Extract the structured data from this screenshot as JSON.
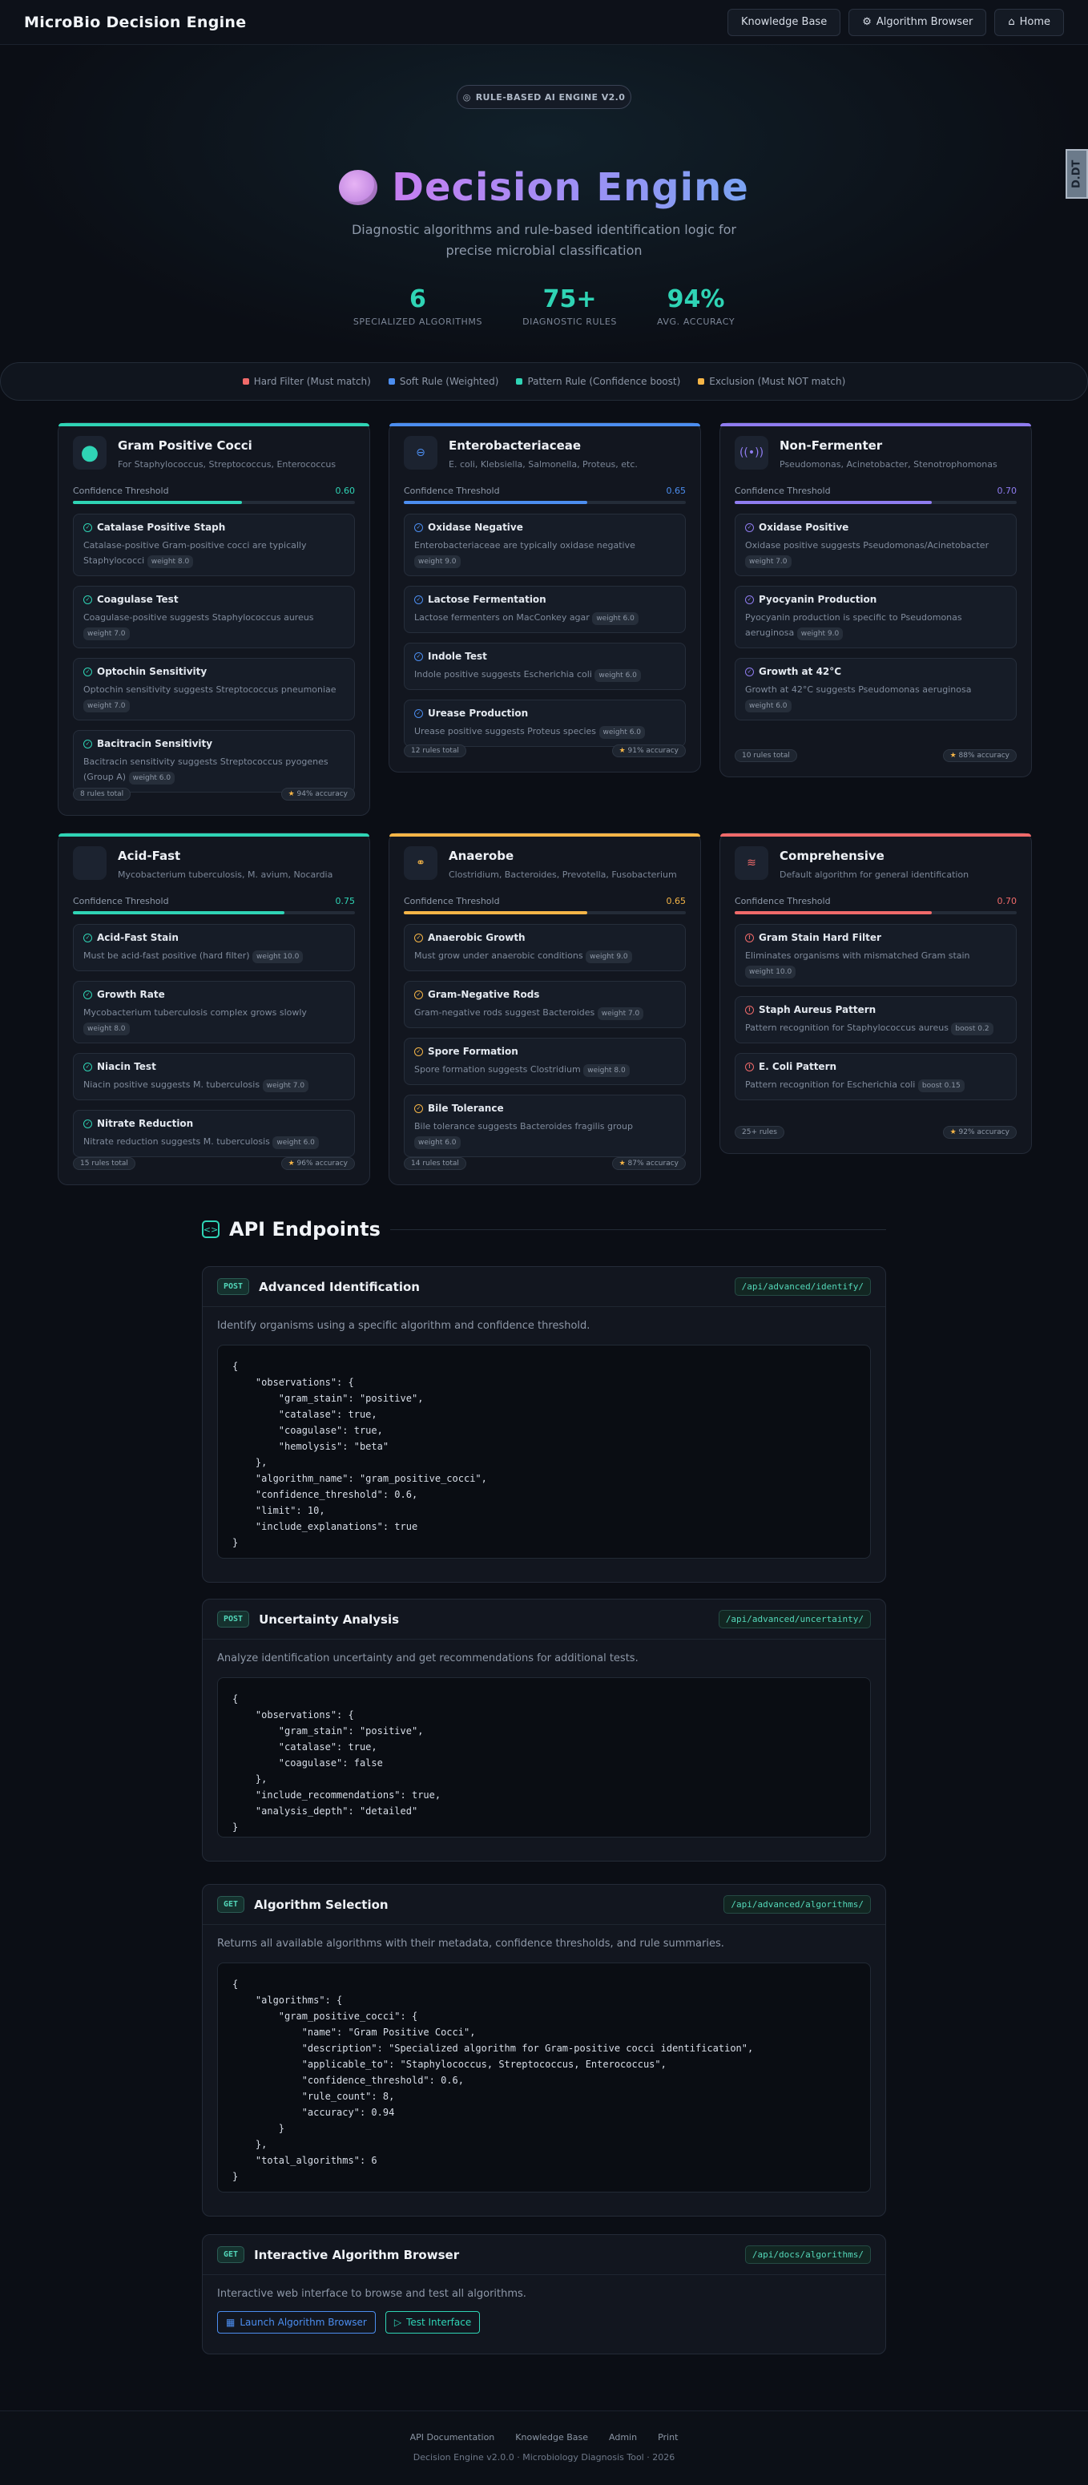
{
  "nav": {
    "brand": "MicroBio Decision Engine",
    "buttons": [
      {
        "label": "Knowledge Base",
        "icon": ""
      },
      {
        "label": "Algorithm Browser",
        "icon": "gear-icon"
      },
      {
        "label": "Home",
        "icon": "home-icon"
      }
    ]
  },
  "hero": {
    "badge": "RULE-BASED AI ENGINE V2.0",
    "title": "Decision Engine",
    "subtitle": "Diagnostic algorithms and rule-based identification logic for precise microbial classification",
    "stats": [
      {
        "value": "6",
        "label": "SPECIALIZED ALGORITHMS"
      },
      {
        "value": "75+",
        "label": "DIAGNOSTIC RULES"
      },
      {
        "value": "94%",
        "label": "AVG. ACCURACY"
      }
    ],
    "side_tab": "D.DT"
  },
  "legend": [
    {
      "label": "Hard Filter (Must match)",
      "color": "#f06a6a"
    },
    {
      "label": "Soft Rule (Weighted)",
      "color": "#4c8ef0"
    },
    {
      "label": "Pattern Rule (Confidence boost)",
      "color": "#2fd4b5"
    },
    {
      "label": "Exclusion (Must NOT match)",
      "color": "#f5b547"
    }
  ],
  "cards": [
    {
      "title": "Gram Positive Cocci",
      "subtitle": "For Staphylococcus, Streptococcus, Enterococcus",
      "threshold_label": "Confidence Threshold",
      "threshold": "0.60",
      "fill": 0.6,
      "accent": "#2fd4b5",
      "icon": "cocci-icon",
      "rules": [
        {
          "title": "Catalase Positive Staph",
          "desc": "Catalase-positive Gram-positive cocci are typically Staphylococci",
          "weight": "weight 8.0"
        },
        {
          "title": "Coagulase Test",
          "desc": "Coagulase-positive suggests Staphylococcus aureus",
          "weight": "weight 7.0"
        },
        {
          "title": "Optochin Sensitivity",
          "desc": "Optochin sensitivity suggests Streptococcus pneumoniae",
          "weight": "weight 7.0"
        },
        {
          "title": "Bacitracin Sensitivity",
          "desc": "Bacitracin sensitivity suggests Streptococcus pyogenes (Group A)",
          "weight": "weight 6.0"
        }
      ],
      "total": "8 rules total",
      "accuracy": "94% accuracy"
    },
    {
      "title": "Enterobacteriaceae",
      "subtitle": "E. coli, Klebsiella, Salmonella, Proteus, etc.",
      "threshold_label": "Confidence Threshold",
      "threshold": "0.65",
      "fill": 0.65,
      "accent": "#4c8ef0",
      "icon": "minus-circle-icon",
      "rules": [
        {
          "title": "Oxidase Negative",
          "desc": "Enterobacteriaceae are typically oxidase negative",
          "weight": "weight 9.0"
        },
        {
          "title": "Lactose Fermentation",
          "desc": "Lactose fermenters on MacConkey agar",
          "weight": "weight 6.0"
        },
        {
          "title": "Indole Test",
          "desc": "Indole positive suggests Escherichia coli",
          "weight": "weight 6.0"
        },
        {
          "title": "Urease Production",
          "desc": "Urease positive suggests Proteus species",
          "weight": "weight 6.0"
        }
      ],
      "total": "12 rules total",
      "accuracy": "91% accuracy"
    },
    {
      "title": "Non-Fermenter",
      "subtitle": "Pseudomonas, Acinetobacter, Stenotrophomonas",
      "threshold_label": "Confidence Threshold",
      "threshold": "0.70",
      "fill": 0.7,
      "accent": "#8f7cf0",
      "icon": "signal-icon",
      "rules": [
        {
          "title": "Oxidase Positive",
          "desc": "Oxidase positive suggests Pseudomonas/Acinetobacter",
          "weight": "weight 7.0"
        },
        {
          "title": "Pyocyanin Production",
          "desc": "Pyocyanin production is specific to Pseudomonas aeruginosa",
          "weight": "weight 9.0"
        },
        {
          "title": "Growth at 42°C",
          "desc": "Growth at 42°C suggests Pseudomonas aeruginosa",
          "weight": "weight 6.0"
        }
      ],
      "total": "10 rules total",
      "accuracy": "88% accuracy"
    },
    {
      "title": "Acid-Fast",
      "subtitle": "Mycobacterium tuberculosis, M. avium, Nocardia",
      "threshold_label": "Confidence Threshold",
      "threshold": "0.75",
      "fill": 0.75,
      "accent": "#2fd4b5",
      "icon": "",
      "rules": [
        {
          "title": "Acid-Fast Stain",
          "desc": "Must be acid-fast positive (hard filter)",
          "weight": "weight 10.0"
        },
        {
          "title": "Growth Rate",
          "desc": "Mycobacterium tuberculosis complex grows slowly",
          "weight": "weight 8.0"
        },
        {
          "title": "Niacin Test",
          "desc": "Niacin positive suggests M. tuberculosis",
          "weight": "weight 7.0"
        },
        {
          "title": "Nitrate Reduction",
          "desc": "Nitrate reduction suggests M. tuberculosis",
          "weight": "weight 6.0"
        }
      ],
      "total": "15 rules total",
      "accuracy": "96% accuracy"
    },
    {
      "title": "Anaerobe",
      "subtitle": "Clostridium, Bacteroides, Prevotella, Fusobacterium",
      "threshold_label": "Confidence Threshold",
      "threshold": "0.65",
      "fill": 0.65,
      "accent": "#f5b547",
      "icon": "molecule-icon",
      "rules": [
        {
          "title": "Anaerobic Growth",
          "desc": "Must grow under anaerobic conditions",
          "weight": "weight 9.0"
        },
        {
          "title": "Gram-Negative Rods",
          "desc": "Gram-negative rods suggest Bacteroides",
          "weight": "weight 7.0"
        },
        {
          "title": "Spore Formation",
          "desc": "Spore formation suggests Clostridium",
          "weight": "weight 8.0"
        },
        {
          "title": "Bile Tolerance",
          "desc": "Bile tolerance suggests Bacteroides fragilis group",
          "weight": "weight 6.0"
        }
      ],
      "total": "14 rules total",
      "accuracy": "87% accuracy"
    },
    {
      "title": "Comprehensive",
      "subtitle": "Default algorithm for general identification",
      "threshold_label": "Confidence Threshold",
      "threshold": "0.70",
      "fill": 0.7,
      "accent": "#f06a6a",
      "icon": "layers-icon",
      "rules": [
        {
          "title": "Gram Stain Hard Filter",
          "desc": "Eliminates organisms with mismatched Gram stain",
          "weight": "weight 10.0"
        },
        {
          "title": "Staph Aureus Pattern",
          "desc": "Pattern recognition for Staphylococcus aureus",
          "weight": "boost 0.2"
        },
        {
          "title": "E. Coli Pattern",
          "desc": "Pattern recognition for Escherichia coli",
          "weight": "boost 0.15"
        }
      ],
      "total": "25+ rules",
      "accuracy": "92% accuracy"
    }
  ],
  "api": {
    "heading": "API Endpoints",
    "endpoints": [
      {
        "method": "POST",
        "name": "Advanced Identification",
        "path": "/api/advanced/identify/",
        "desc": "Identify organisms using a specific algorithm and confidence threshold.",
        "code": "{\n    \"observations\": {\n        \"gram_stain\": \"positive\",\n        \"catalase\": true,\n        \"coagulase\": true,\n        \"hemolysis\": \"beta\"\n    },\n    \"algorithm_name\": \"gram_positive_cocci\",\n    \"confidence_threshold\": 0.6,\n    \"limit\": 10,\n    \"include_explanations\": true\n}"
      },
      {
        "method": "POST",
        "name": "Uncertainty Analysis",
        "path": "/api/advanced/uncertainty/",
        "desc": "Analyze identification uncertainty and get recommendations for additional tests.",
        "code": "{\n    \"observations\": {\n        \"gram_stain\": \"positive\",\n        \"catalase\": true,\n        \"coagulase\": false\n    },\n    \"include_recommendations\": true,\n    \"analysis_depth\": \"detailed\"\n}"
      },
      {
        "method": "GET",
        "name": "Algorithm Selection",
        "path": "/api/advanced/algorithms/",
        "desc": "Returns all available algorithms with their metadata, confidence thresholds, and rule summaries.",
        "code": "{\n    \"algorithms\": {\n        \"gram_positive_cocci\": {\n            \"name\": \"Gram Positive Cocci\",\n            \"description\": \"Specialized algorithm for Gram-positive cocci identification\",\n            \"applicable_to\": \"Staphylococcus, Streptococcus, Enterococcus\",\n            \"confidence_threshold\": 0.6,\n            \"rule_count\": 8,\n            \"accuracy\": 0.94\n        }\n    },\n    \"total_algorithms\": 6\n}"
      },
      {
        "method": "GET",
        "name": "Interactive Algorithm Browser",
        "path": "/api/docs/algorithms/",
        "desc": "Interactive web interface to browse and test all algorithms.",
        "buttons": [
          {
            "label": "Launch Algorithm Browser",
            "color": "#4c8ef0"
          },
          {
            "label": "Test Interface",
            "color": "#2fd4b5"
          }
        ]
      }
    ]
  },
  "footer": {
    "links": [
      "API Documentation",
      "Knowledge Base",
      "Admin",
      "Print"
    ],
    "copy": "Decision Engine v2.0.0 · Microbiology Diagnosis Tool · 2026"
  }
}
